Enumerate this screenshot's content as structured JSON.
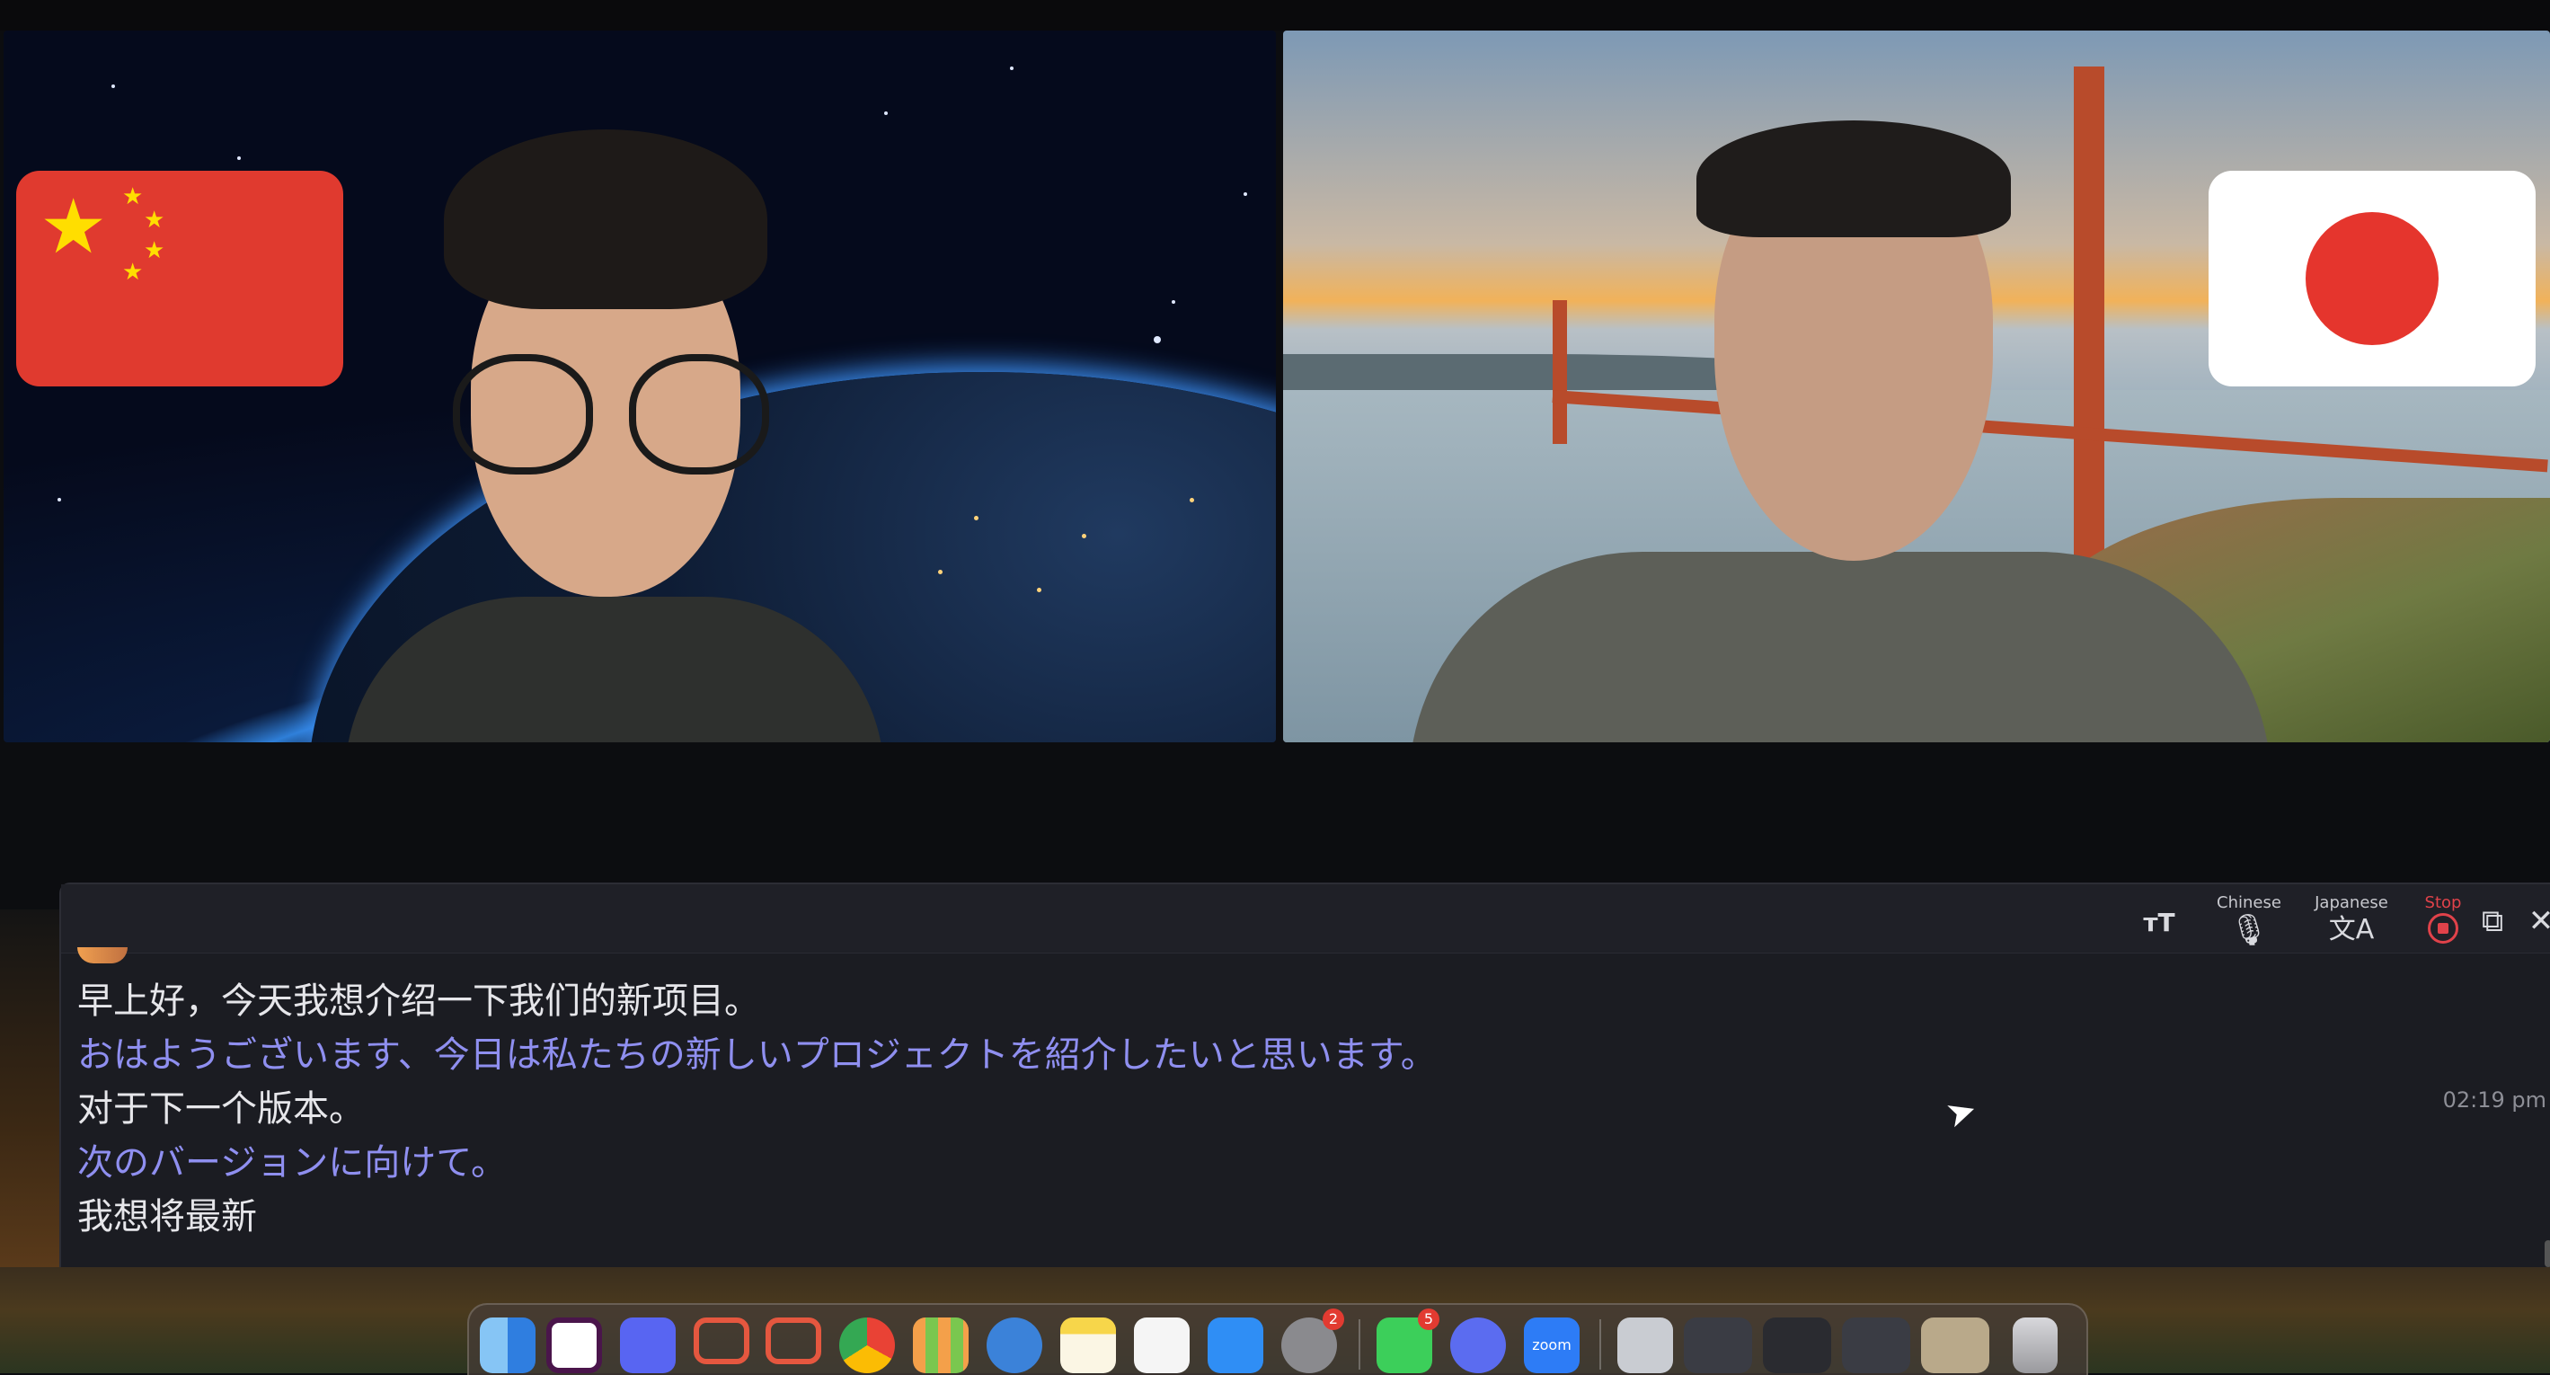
{
  "participants": [
    {
      "flag": "china-flag-icon",
      "background": "earth-from-space"
    },
    {
      "flag": "japan-flag-icon",
      "background": "golden-gate-bridge-sunset"
    }
  ],
  "translation_panel": {
    "controls": {
      "text_size_icon": "text-size-icon",
      "source_language_label": "Chinese",
      "source_icon": "microphone-icon",
      "target_language_label": "Japanese",
      "target_icon": "translate-icon",
      "stop_label": "Stop",
      "stop_icon": "stop-record-icon",
      "popout_icon": "popout-icon",
      "close_icon": "close-icon"
    },
    "transcript": [
      {
        "lang": "zh",
        "text": "早上好，今天我想介绍一下我们的新项目。"
      },
      {
        "lang": "ja",
        "text": "おはようございます、今日は私たちの新しいプロジェクトを紹介したいと思います。"
      },
      {
        "lang": "zh",
        "text": "对于下一个版本。"
      },
      {
        "lang": "ja",
        "text": "次のバージョンに向けて。"
      },
      {
        "lang": "zh",
        "text": "我想将最新"
      }
    ],
    "timestamp": "02:19 pm"
  },
  "dock": {
    "apps": [
      {
        "name": "finder-icon",
        "color": "#4aa3f0"
      },
      {
        "name": "slack-icon",
        "color": "#4a154b"
      },
      {
        "name": "discord-icon",
        "color": "#5865f2"
      },
      {
        "name": "chat-app-icon",
        "color": "#e5573f"
      },
      {
        "name": "chat-app-2-icon",
        "color": "#e5573f"
      },
      {
        "name": "chrome-icon",
        "color": "#f2f2f2"
      },
      {
        "name": "launchpad-icon",
        "color": "#f4a04a"
      },
      {
        "name": "safari-icon",
        "color": "#3b82d9"
      },
      {
        "name": "notes-icon",
        "color": "#f7d64a"
      },
      {
        "name": "freeform-icon",
        "color": "#f5f5f5"
      },
      {
        "name": "app-store-icon",
        "color": "#2f8ef5"
      },
      {
        "name": "system-settings-icon",
        "color": "#8a8a8e",
        "badge": "2"
      },
      {
        "name": "facetime-icon",
        "color": "#3ccf5a",
        "badge": "5"
      },
      {
        "name": "perplexity-icon",
        "color": "#5b6cf0"
      },
      {
        "name": "zoom-icon",
        "color": "#2d7cf6",
        "text": "zoom"
      },
      {
        "name": "document-icon",
        "color": "#c9ccd2"
      },
      {
        "name": "window-thumbnail-1-icon",
        "color": "#3a3c44"
      },
      {
        "name": "window-thumbnail-2-icon",
        "color": "#2a2b30"
      },
      {
        "name": "window-thumbnail-3-icon",
        "color": "#3a3c44"
      },
      {
        "name": "window-thumbnail-4-icon",
        "color": "#b9a98a"
      },
      {
        "name": "trash-icon",
        "color": "#b8b8bc"
      }
    ]
  }
}
